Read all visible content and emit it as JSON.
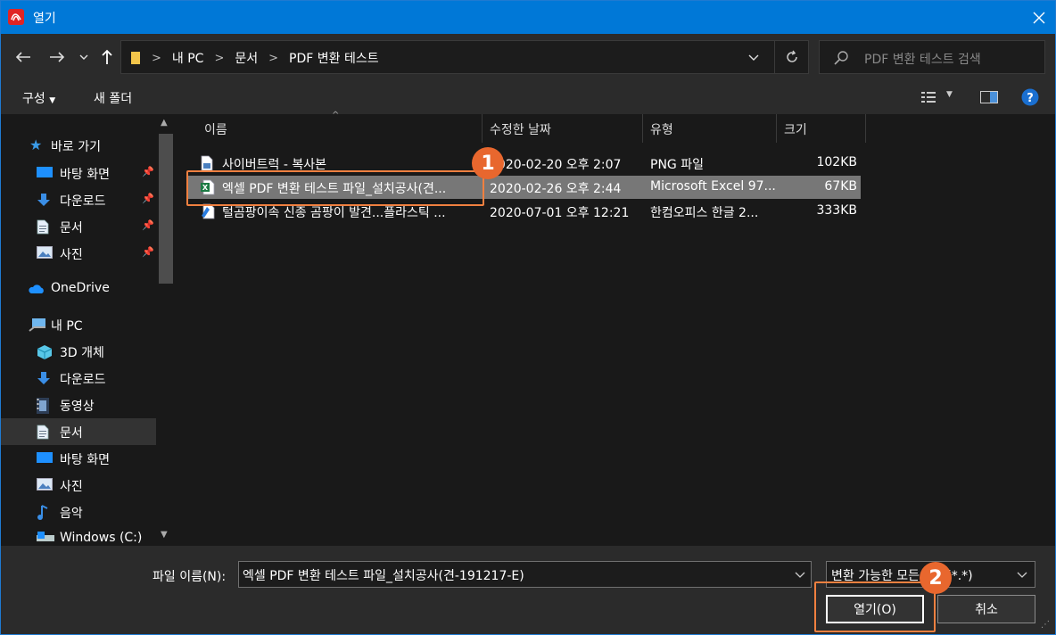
{
  "window": {
    "title": "열기",
    "accent": "#0078d7"
  },
  "nav": {
    "breadcrumbs": [
      "내 PC",
      "문서",
      "PDF 변환 테스트"
    ],
    "search_placeholder": "PDF 변환 테스트 검색"
  },
  "commandbar": {
    "organize": "구성",
    "new_folder": "새 폴더"
  },
  "sidebar": {
    "quick_access": "바로 가기",
    "items": [
      {
        "label": "바탕 화면",
        "icon": "desktop-icon",
        "pinned": true
      },
      {
        "label": "다운로드",
        "icon": "download-icon",
        "pinned": true
      },
      {
        "label": "문서",
        "icon": "document-icon",
        "pinned": true
      },
      {
        "label": "사진",
        "icon": "pictures-icon",
        "pinned": true
      }
    ],
    "onedrive": "OneDrive",
    "this_pc": "내 PC",
    "pc_items": [
      {
        "label": "3D 개체",
        "icon": "3d-objects-icon"
      },
      {
        "label": "다운로드",
        "icon": "download-icon"
      },
      {
        "label": "동영상",
        "icon": "video-icon"
      },
      {
        "label": "문서",
        "icon": "document-icon",
        "selected": true
      },
      {
        "label": "바탕 화면",
        "icon": "desktop-icon"
      },
      {
        "label": "사진",
        "icon": "pictures-icon"
      },
      {
        "label": "음악",
        "icon": "music-icon"
      },
      {
        "label": "Windows (C:)",
        "icon": "drive-icon"
      }
    ]
  },
  "list": {
    "columns": [
      "이름",
      "수정한 날짜",
      "유형",
      "크기"
    ],
    "rows": [
      {
        "name": "사이버트럭 - 복사본",
        "date": "2020-02-20 오후 2:07",
        "type": "PNG 파일",
        "size": "102KB",
        "icon": "png-file-icon",
        "selected": false
      },
      {
        "name": "엑셀 PDF 변환 테스트 파일_설치공사(견...",
        "date": "2020-02-26 오후 2:44",
        "type": "Microsoft Excel 97...",
        "size": "67KB",
        "icon": "excel-file-icon",
        "selected": true
      },
      {
        "name": "털곰팡이속 신종 곰팡이 발견...플라스틱 ...",
        "date": "2020-07-01 오후 12:21",
        "type": "한컴오피스 한글 2...",
        "size": "333KB",
        "icon": "hwp-file-icon",
        "selected": false
      }
    ]
  },
  "footer": {
    "filename_label": "파일 이름(N):",
    "filename_value": "엑셀 PDF 변환 테스트 파일_설치공사(견-191217-E)",
    "filetype_value": "변환 가능한 모든 파일(*.*)",
    "open_button": "열기(O)",
    "cancel_button": "취소"
  },
  "annotations": {
    "badge1": "1",
    "badge2": "2",
    "color": "#e8672e"
  }
}
